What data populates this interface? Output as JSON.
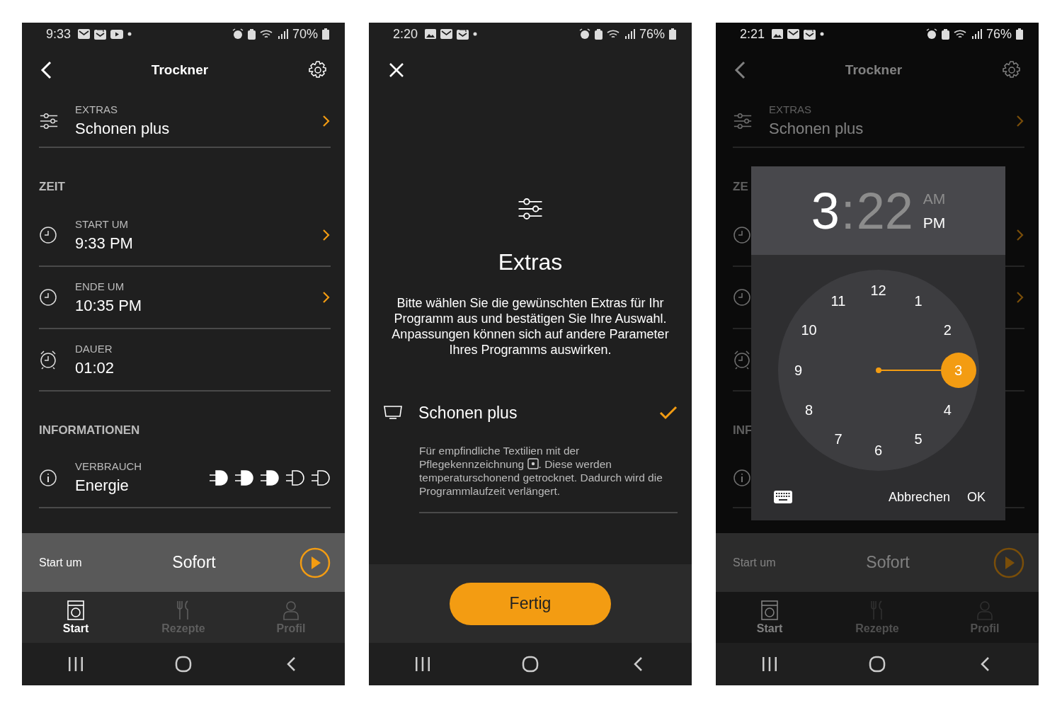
{
  "screens": [
    {
      "kind": "program",
      "dimmed": false,
      "status_bar": {
        "time": "9:33",
        "notifications": [
          {
            "kind": "mail"
          },
          {
            "kind": "mail_open"
          },
          {
            "kind": "video"
          }
        ],
        "battery": "70%"
      },
      "header": {
        "title": "Trockner"
      },
      "extras": {
        "label": "EXTRAS",
        "value": "Schonen plus"
      },
      "sections": [
        {
          "title": "ZEIT",
          "rows": [
            {
              "kind": "clock",
              "label": "START UM",
              "value": "9:33 PM",
              "chevron": true
            },
            {
              "kind": "clock",
              "label": "ENDE UM",
              "value": "10:35 PM",
              "chevron": true
            },
            {
              "kind": "alarm",
              "label": "DAUER",
              "value": "01:02",
              "chevron": false
            }
          ]
        },
        {
          "title": "INFORMATIONEN",
          "rows": [
            {
              "kind": "info",
              "label": "VERBRAUCH",
              "value": "Energie",
              "chevron": false,
              "stars": 3
            }
          ]
        }
      ],
      "start_bar": {
        "label": "Start um",
        "value": "Sofort"
      },
      "tabs": [
        {
          "kind": "start",
          "label": "Start",
          "selected": true
        },
        {
          "kind": "recipes",
          "label": "Rezepte",
          "selected": false
        },
        {
          "kind": "profile",
          "label": "Profil",
          "selected": false
        }
      ]
    },
    {
      "kind": "extras",
      "dimmed": false,
      "status_bar": {
        "time": "2:20",
        "notifications": [
          {
            "kind": "image"
          },
          {
            "kind": "mail"
          },
          {
            "kind": "mail_open"
          }
        ],
        "battery": "76%"
      },
      "title": "Extras",
      "intro": "Bitte wählen Sie die gewünschten Extras für Ihr Programm aus und bestätigen Sie Ihre Auswahl. Anpassungen können sich auf andere Parameter Ihres Programms auswirken.",
      "options": [
        {
          "title": "Schonen plus",
          "selected": true,
          "description_before": "Für empfindliche Textilien mit der Pflegekennzeichnung",
          "description_after": ". Diese werden temperaturschonend getrocknet. Dadurch wird die Programmlaufzeit verlängert."
        }
      ],
      "done_button": "Fertig"
    },
    {
      "kind": "time_picker",
      "dimmed": true,
      "status_bar": {
        "time": "2:21",
        "notifications": [
          {
            "kind": "image"
          },
          {
            "kind": "mail"
          },
          {
            "kind": "mail_open"
          }
        ],
        "battery": "76%"
      },
      "header": {
        "title": "Trockner"
      },
      "extras": {
        "label": "EXTRAS",
        "value": "Schonen plus"
      },
      "sections": [
        {
          "title": "ZE",
          "rows": [
            {
              "kind": "clock",
              "chevron": true
            },
            {
              "kind": "clock",
              "chevron": true
            },
            {
              "kind": "alarm",
              "chevron": false
            }
          ]
        },
        {
          "title": "INF",
          "rows": [
            {
              "kind": "info",
              "chevron": false
            }
          ]
        }
      ],
      "start_bar": {
        "label": "Start um",
        "value": "Sofort"
      },
      "tabs": [
        {
          "kind": "start",
          "label": "Start",
          "selected": true
        },
        {
          "kind": "recipes",
          "label": "Rezepte",
          "selected": false
        },
        {
          "kind": "profile",
          "label": "Profil",
          "selected": false
        }
      ],
      "dialog": {
        "hour": {
          "text": "3",
          "selected": true
        },
        "separator": ":",
        "minute": {
          "text": "22",
          "selected": false
        },
        "periods": [
          {
            "label": "AM",
            "selected": false
          },
          {
            "label": "PM",
            "selected": true
          }
        ],
        "dial": [
          {
            "label": "12",
            "selected": false
          },
          {
            "label": "1",
            "selected": false
          },
          {
            "label": "2",
            "selected": false
          },
          {
            "label": "3",
            "selected": true
          },
          {
            "label": "4",
            "selected": false
          },
          {
            "label": "5",
            "selected": false
          },
          {
            "label": "6",
            "selected": false
          },
          {
            "label": "7",
            "selected": false
          },
          {
            "label": "8",
            "selected": false
          },
          {
            "label": "9",
            "selected": false
          },
          {
            "label": "10",
            "selected": false
          },
          {
            "label": "11",
            "selected": false
          }
        ],
        "buttons": [
          {
            "label": "Abbrechen"
          },
          {
            "label": "OK"
          }
        ]
      }
    }
  ]
}
